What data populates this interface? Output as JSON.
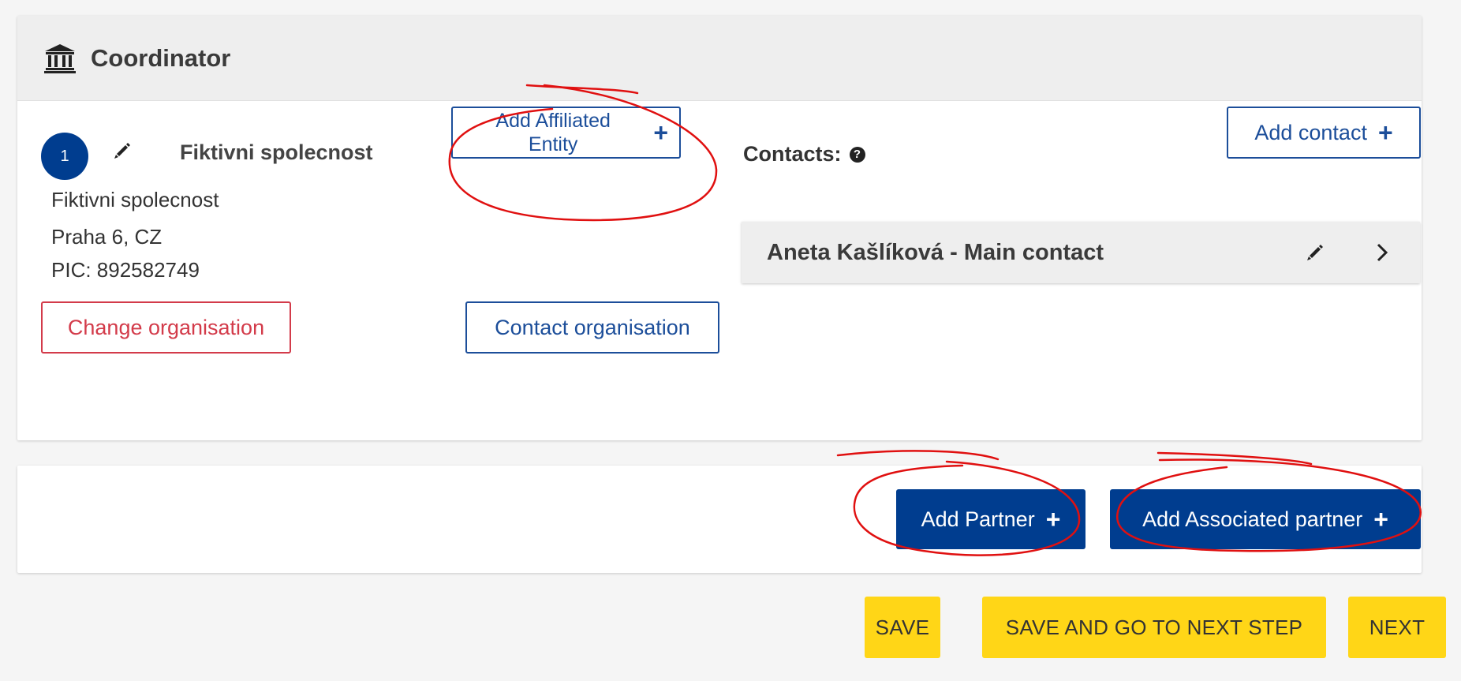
{
  "coordinator": {
    "title": "Coordinator",
    "badge_number": "1",
    "org_short_name": "Fiktivni spolecnost",
    "add_affiliated_label_line1": "Add Affiliated",
    "add_affiliated_label_line2": "Entity",
    "address": {
      "name": "Fiktivni spolecnost",
      "city": "Praha 6, CZ",
      "pic": "PIC: 892582749"
    },
    "change_org_label": "Change organisation",
    "contact_org_label": "Contact organisation",
    "contacts_label": "Contacts:",
    "add_contact_label": "Add contact",
    "contact": {
      "name": "Aneta Kašlíková - Main contact"
    }
  },
  "partners": {
    "add_partner_label": "Add Partner",
    "add_associated_label": "Add Associated partner"
  },
  "footer": {
    "save_label": "SAVE",
    "save_next_label": "SAVE AND GO TO NEXT STEP",
    "next_label": "NEXT"
  },
  "icons": {
    "header_icon": "institution-icon",
    "edit_icon": "pencil-icon",
    "help_icon": "question-circle-icon",
    "chevron_icon": "chevron-right-icon",
    "plus_icon": "plus-icon"
  },
  "colors": {
    "primary_blue": "#003d8f",
    "outline_blue": "#1c4e9a",
    "danger_red": "#d33b4a",
    "action_yellow": "#ffd617",
    "annotation_red": "#e01010"
  }
}
